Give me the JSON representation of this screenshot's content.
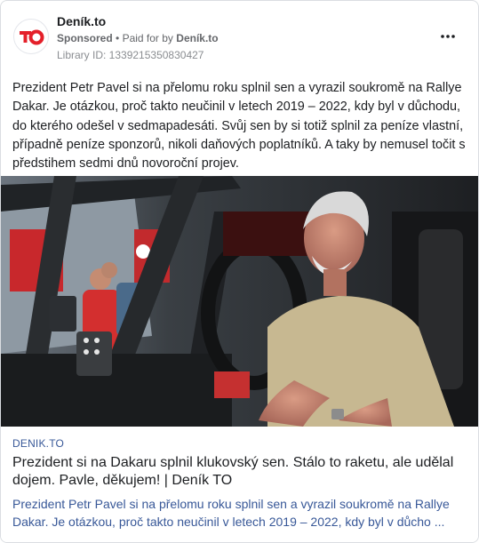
{
  "header": {
    "page_name": "Deník.to",
    "sponsored_label": "Sponsored",
    "separator": "•",
    "paid_for_by_label": "Paid for by",
    "paid_for_by": "Deník.to",
    "library_id": "Library ID: 1339215350830427",
    "more_icon": "more-horizontal-icon",
    "logo_icon": "deník-to-logo"
  },
  "post": {
    "text": "Prezident Petr Pavel si na přelomu roku splnil sen a vyrazil soukromě na Rallye Dakar. Je otázkou, proč takto neučinil v letech 2019 – 2022, kdy byl v důchodu, do kterého odešel v sedmapadesáti. Svůj sen by si totiž splnil za peníze vlastní, případně peníze sponzorů, nikoli daňových poplatníků. A taky by nemusel točit s předstihem sedmi dnů novoroční projev."
  },
  "link": {
    "domain": "DENIK.TO",
    "title": "Prezident si na Dakaru splnil klukovský sen. Stálo to raketu, ale udělal dojem. Pavle, děkujem! | Deník TO",
    "description": "Prezident Petr Pavel si na přelomu roku splnil sen a vyrazil soukromě na Rallye Dakar. Je otázkou, proč takto neučinil v letech 2019 – 2022, kdy byl v důcho ..."
  },
  "colors": {
    "brand_red": "#e4202a",
    "link_blue": "#385898",
    "meta_gray": "#65676b"
  }
}
